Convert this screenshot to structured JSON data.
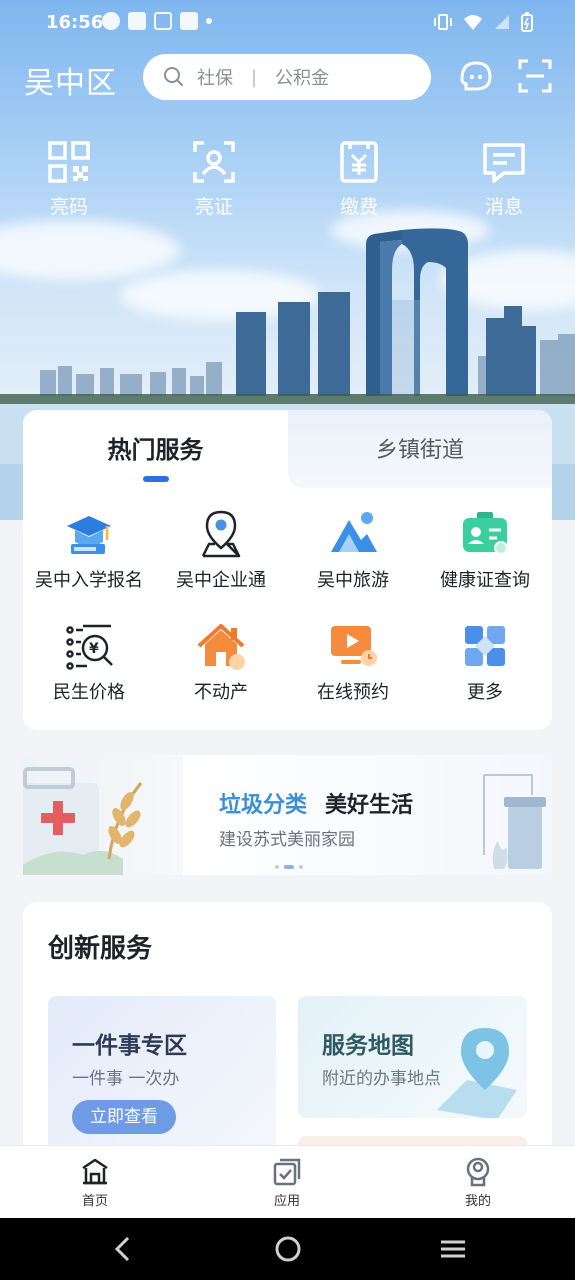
{
  "status_bar": {
    "time": "16:56"
  },
  "header": {
    "city": "吴中区",
    "search_keyword_1": "社保",
    "search_separator": "|",
    "search_keyword_2": "公积金"
  },
  "quick_actions": [
    {
      "label": "亮码",
      "icon": "qr-code-icon"
    },
    {
      "label": "亮证",
      "icon": "id-card-icon"
    },
    {
      "label": "缴费",
      "icon": "payment-icon"
    },
    {
      "label": "消息",
      "icon": "message-icon"
    }
  ],
  "service_tabs": [
    {
      "label": "热门服务",
      "active": true
    },
    {
      "label": "乡镇街道",
      "active": false
    }
  ],
  "services": [
    {
      "label": "吴中入学报名",
      "icon": "graduation-cap-icon"
    },
    {
      "label": "吴中企业通",
      "icon": "location-pin-icon"
    },
    {
      "label": "吴中旅游",
      "icon": "mountain-travel-icon"
    },
    {
      "label": "健康证查询",
      "icon": "health-card-icon"
    },
    {
      "label": "民生价格",
      "icon": "price-search-icon"
    },
    {
      "label": "不动产",
      "icon": "house-icon"
    },
    {
      "label": "在线预约",
      "icon": "video-appointment-icon"
    },
    {
      "label": "更多",
      "icon": "more-grid-icon"
    }
  ],
  "banner": {
    "title_highlight": "垃圾分类",
    "title_rest": "美好生活",
    "subtitle": "建设苏式美丽家园"
  },
  "innovation": {
    "title": "创新服务",
    "card_a": {
      "title": "一件事专区",
      "subtitle": "一件事 一次办",
      "button": "立即查看"
    },
    "card_b": {
      "title": "服务地图",
      "subtitle": "附近的办事地点"
    }
  },
  "bottom_nav": [
    {
      "label": "首页",
      "icon": "home-icon",
      "active": true
    },
    {
      "label": "应用",
      "icon": "apps-icon",
      "active": false
    },
    {
      "label": "我的",
      "icon": "profile-icon",
      "active": false
    }
  ],
  "colors": {
    "accent": "#2f6fe0",
    "banner_highlight": "#3a8fd8",
    "button": "#6f9be6"
  }
}
